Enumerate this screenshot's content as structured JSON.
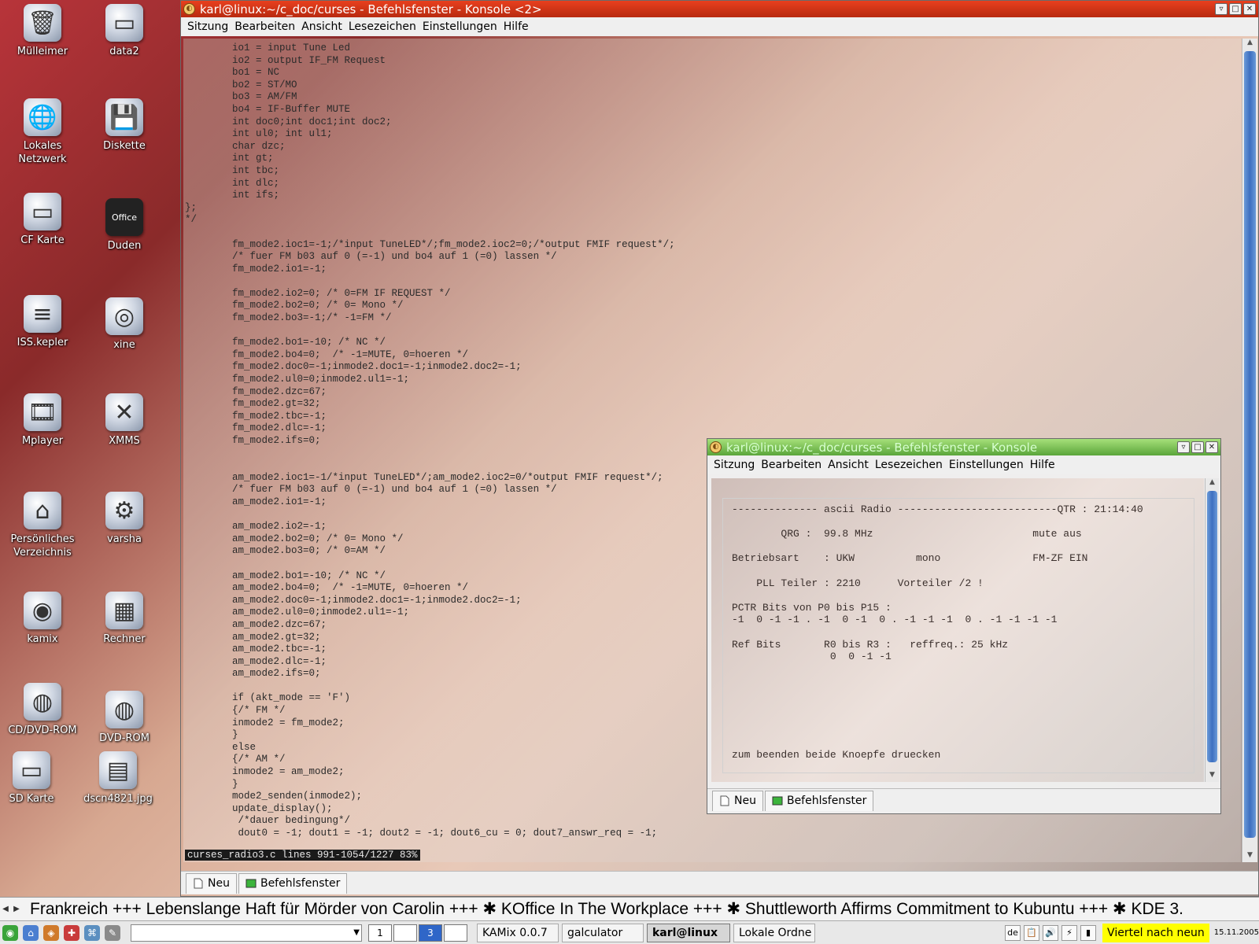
{
  "desktop": {
    "icons": [
      {
        "label": "Mülleimer",
        "glyph": "🗑"
      },
      {
        "label": "data2",
        "glyph": "▭"
      },
      {
        "label": "Lokales Netzwerk",
        "glyph": "🌐"
      },
      {
        "label": "Diskette",
        "glyph": "💾"
      },
      {
        "label": "CF Karte",
        "glyph": "▭"
      },
      {
        "label": "Duden",
        "glyph": "Office"
      },
      {
        "label": "ISS.kepler",
        "glyph": "≡"
      },
      {
        "label": "xine",
        "glyph": "◎"
      },
      {
        "label": "Mplayer",
        "glyph": "🎞"
      },
      {
        "label": "XMMS",
        "glyph": "✕"
      },
      {
        "label": "Persönliches Verzeichnis",
        "glyph": "⌂"
      },
      {
        "label": "varsha",
        "glyph": "⚙"
      },
      {
        "label": "kamix",
        "glyph": "◉"
      },
      {
        "label": "Rechner",
        "glyph": "▦"
      },
      {
        "label": "CD/DVD-ROM",
        "glyph": "◍"
      },
      {
        "label": "DVD-ROM",
        "glyph": "◍"
      },
      {
        "label": "SD Karte",
        "glyph": "▭"
      },
      {
        "label": "dscn4821.jpg",
        "glyph": "▤"
      }
    ]
  },
  "main_window": {
    "title": "karl@linux:~/c_doc/curses - Befehlsfenster - Konsole <2>",
    "menu": [
      "Sitzung",
      "Bearbeiten",
      "Ansicht",
      "Lesezeichen",
      "Einstellungen",
      "Hilfe"
    ],
    "code_lines": [
      "        io1 = input Tune Led",
      "        io2 = output IF_FM Request",
      "        bo1 = NC",
      "        bo2 = ST/MO",
      "        bo3 = AM/FM",
      "        bo4 = IF-Buffer MUTE",
      "        int doc0;int doc1;int doc2;",
      "        int ul0; int ul1;",
      "        char dzc;",
      "        int gt;",
      "        int tbc;",
      "        int dlc;",
      "        int ifs;",
      "};",
      "*/",
      "",
      "        fm_mode2.ioc1=-1;/*input TuneLED*/;fm_mode2.ioc2=0;/*output FMIF request*/;",
      "        /* fuer FM b03 auf 0 (=-1) und bo4 auf 1 (=0) lassen */",
      "        fm_mode2.io1=-1;",
      "",
      "        fm_mode2.io2=0; /* 0=FM IF REQUEST */",
      "        fm_mode2.bo2=0; /* 0= Mono */",
      "        fm_mode2.bo3=-1;/* -1=FM */",
      "",
      "        fm_mode2.bo1=-10; /* NC */",
      "        fm_mode2.bo4=0;  /* -1=MUTE, 0=hoeren */",
      "        fm_mode2.doc0=-1;inmode2.doc1=-1;inmode2.doc2=-1;",
      "        fm_mode2.ul0=0;inmode2.ul1=-1;",
      "        fm_mode2.dzc=67;",
      "        fm_mode2.gt=32;",
      "        fm_mode2.tbc=-1;",
      "        fm_mode2.dlc=-1;",
      "        fm_mode2.ifs=0;",
      "",
      "",
      "        am_mode2.ioc1=-1/*input TuneLED*/;am_mode2.ioc2=0/*output FMIF request*/;",
      "        /* fuer FM b03 auf 0 (=-1) und bo4 auf 1 (=0) lassen */",
      "        am_mode2.io1=-1;",
      "",
      "        am_mode2.io2=-1;",
      "        am_mode2.bo2=0; /* 0= Mono */",
      "        am_mode2.bo3=0; /* 0=AM */",
      "",
      "        am_mode2.bo1=-10; /* NC */",
      "        am_mode2.bo4=0;  /* -1=MUTE, 0=hoeren */",
      "        am_mode2.doc0=-1;inmode2.doc1=-1;inmode2.doc2=-1;",
      "        am_mode2.ul0=0;inmode2.ul1=-1;",
      "        am_mode2.dzc=67;",
      "        am_mode2.gt=32;",
      "        am_mode2.tbc=-1;",
      "        am_mode2.dlc=-1;",
      "        am_mode2.ifs=0;",
      "",
      "        if (akt_mode == 'F')",
      "        {/* FM */",
      "        inmode2 = fm_mode2;",
      "        }",
      "        else",
      "        {/* AM */",
      "        inmode2 = am_mode2;",
      "        }",
      "        mode2_senden(inmode2);",
      "        update_display();",
      "         /*dauer bedingung*/",
      "         dout0 = -1; dout1 = -1; dout2 = -1; dout6_cu = 0; dout7_answr_req = -1;"
    ],
    "status_line": "curses_radio3.c lines 991-1054/1227 83%",
    "tabs": [
      "Neu",
      "Befehlsfenster"
    ]
  },
  "second_window": {
    "title": "karl@linux:~/c_doc/curses - Befehlsfenster - Konsole",
    "menu": [
      "Sitzung",
      "Bearbeiten",
      "Ansicht",
      "Lesezeichen",
      "Einstellungen",
      "Hilfe"
    ],
    "radio_lines": [
      "-------------- ascii Radio --------------------------QTR : 21:14:40",
      "",
      "        QRG :  99.8 MHz                          mute aus",
      "",
      "Betriebsart    : UKW          mono               FM-ZF EIN",
      "",
      "    PLL Teiler : 2210      Vorteiler /2 !",
      "",
      "PCTR Bits von P0 bis P15 :",
      "-1  0 -1 -1 . -1  0 -1  0 . -1 -1 -1  0 . -1 -1 -1 -1",
      "",
      "Ref Bits       R0 bis R3 :   reffreq.: 25 kHz",
      "                0  0 -1 -1",
      "",
      "",
      "",
      "",
      "",
      "",
      "",
      "zum beenden beide Knoepfe druecken"
    ],
    "tabs": [
      "Neu",
      "Befehlsfenster"
    ]
  },
  "ticker": {
    "text": "Frankreich +++  Lebenslange Haft für Mörder von Carolin +++ ✱ KOffice In The Workplace +++ ✱ Shuttleworth Affirms Commitment to Kubuntu +++ ✱ KDE 3."
  },
  "taskbar": {
    "pager": [
      "1",
      "",
      "3",
      ""
    ],
    "tasks": [
      {
        "label": "KAMix 0.0.7"
      },
      {
        "label": "galculator"
      },
      {
        "label": "karl@linux"
      },
      {
        "label": "Lokale Ordne"
      }
    ],
    "tray": [
      "de"
    ],
    "clock": "Viertel nach neun",
    "date": "15.11.2005"
  }
}
